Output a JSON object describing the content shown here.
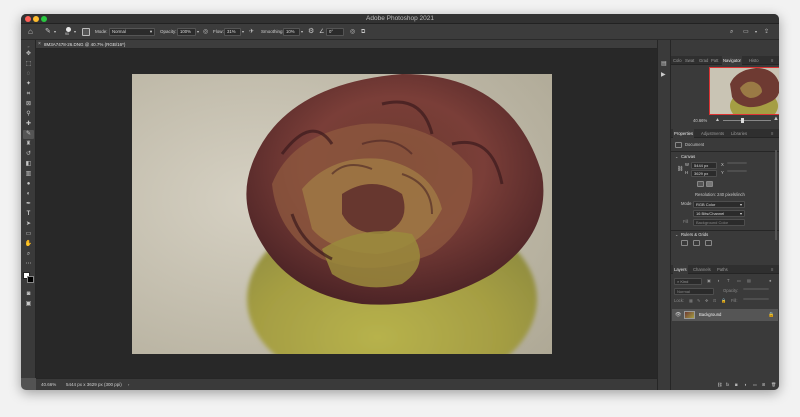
{
  "window": {
    "title": "Adobe Photoshop 2021",
    "traffic_lights": {
      "close": "#fe5f57",
      "minimize": "#febc2e",
      "zoom": "#28c840"
    }
  },
  "options_bar": {
    "home_icon": "home-icon",
    "brush_size": "90",
    "mode_label": "Mode:",
    "mode_value": "Normal",
    "opacity_label": "Opacity:",
    "opacity_value": "100%",
    "flow_label": "Flow:",
    "flow_value": "31%",
    "smoothing_label": "Smoothing:",
    "smoothing_value": "10%",
    "angle_value": "0°"
  },
  "document": {
    "tab_title": "8M3A7478-26.DNG @ 40.7% (RGB/16*)"
  },
  "status_bar": {
    "zoom": "40.66%",
    "dimensions": "5444 px x 3629 px (300 ppi)"
  },
  "navigator_panel": {
    "tabs": [
      "Colo",
      "Swat",
      "Grad",
      "Patt",
      "Navigator",
      "Histo"
    ],
    "active_tab": "Navigator",
    "zoom": "40.66%"
  },
  "properties_panel": {
    "tabs": [
      "Properties",
      "Adjustments",
      "Libraries"
    ],
    "active_tab": "Properties",
    "doc_label": "Document",
    "canvas_header": "Canvas",
    "w_label": "W",
    "w_value": "5444 px",
    "x_label": "X",
    "h_label": "H",
    "h_value": "3629 px",
    "y_label": "Y",
    "resolution": "Resolution: 240 pixels/inch",
    "mode_label": "Mode",
    "mode_value": "RGB Color",
    "bit_value": "16 Bits/Channel",
    "fill_label": "Fill",
    "fill_value": "Background Color",
    "rulers_header": "Rulers & Grids"
  },
  "layers_panel": {
    "tabs": [
      "Layers",
      "Channels",
      "Paths"
    ],
    "active_tab": "Layers",
    "kind_placeholder": "Kind",
    "blend_value": "Normal",
    "opacity_label": "Opacity:",
    "lock_label": "Lock:",
    "fill_label": "Fill:",
    "layer_name": "Background"
  }
}
